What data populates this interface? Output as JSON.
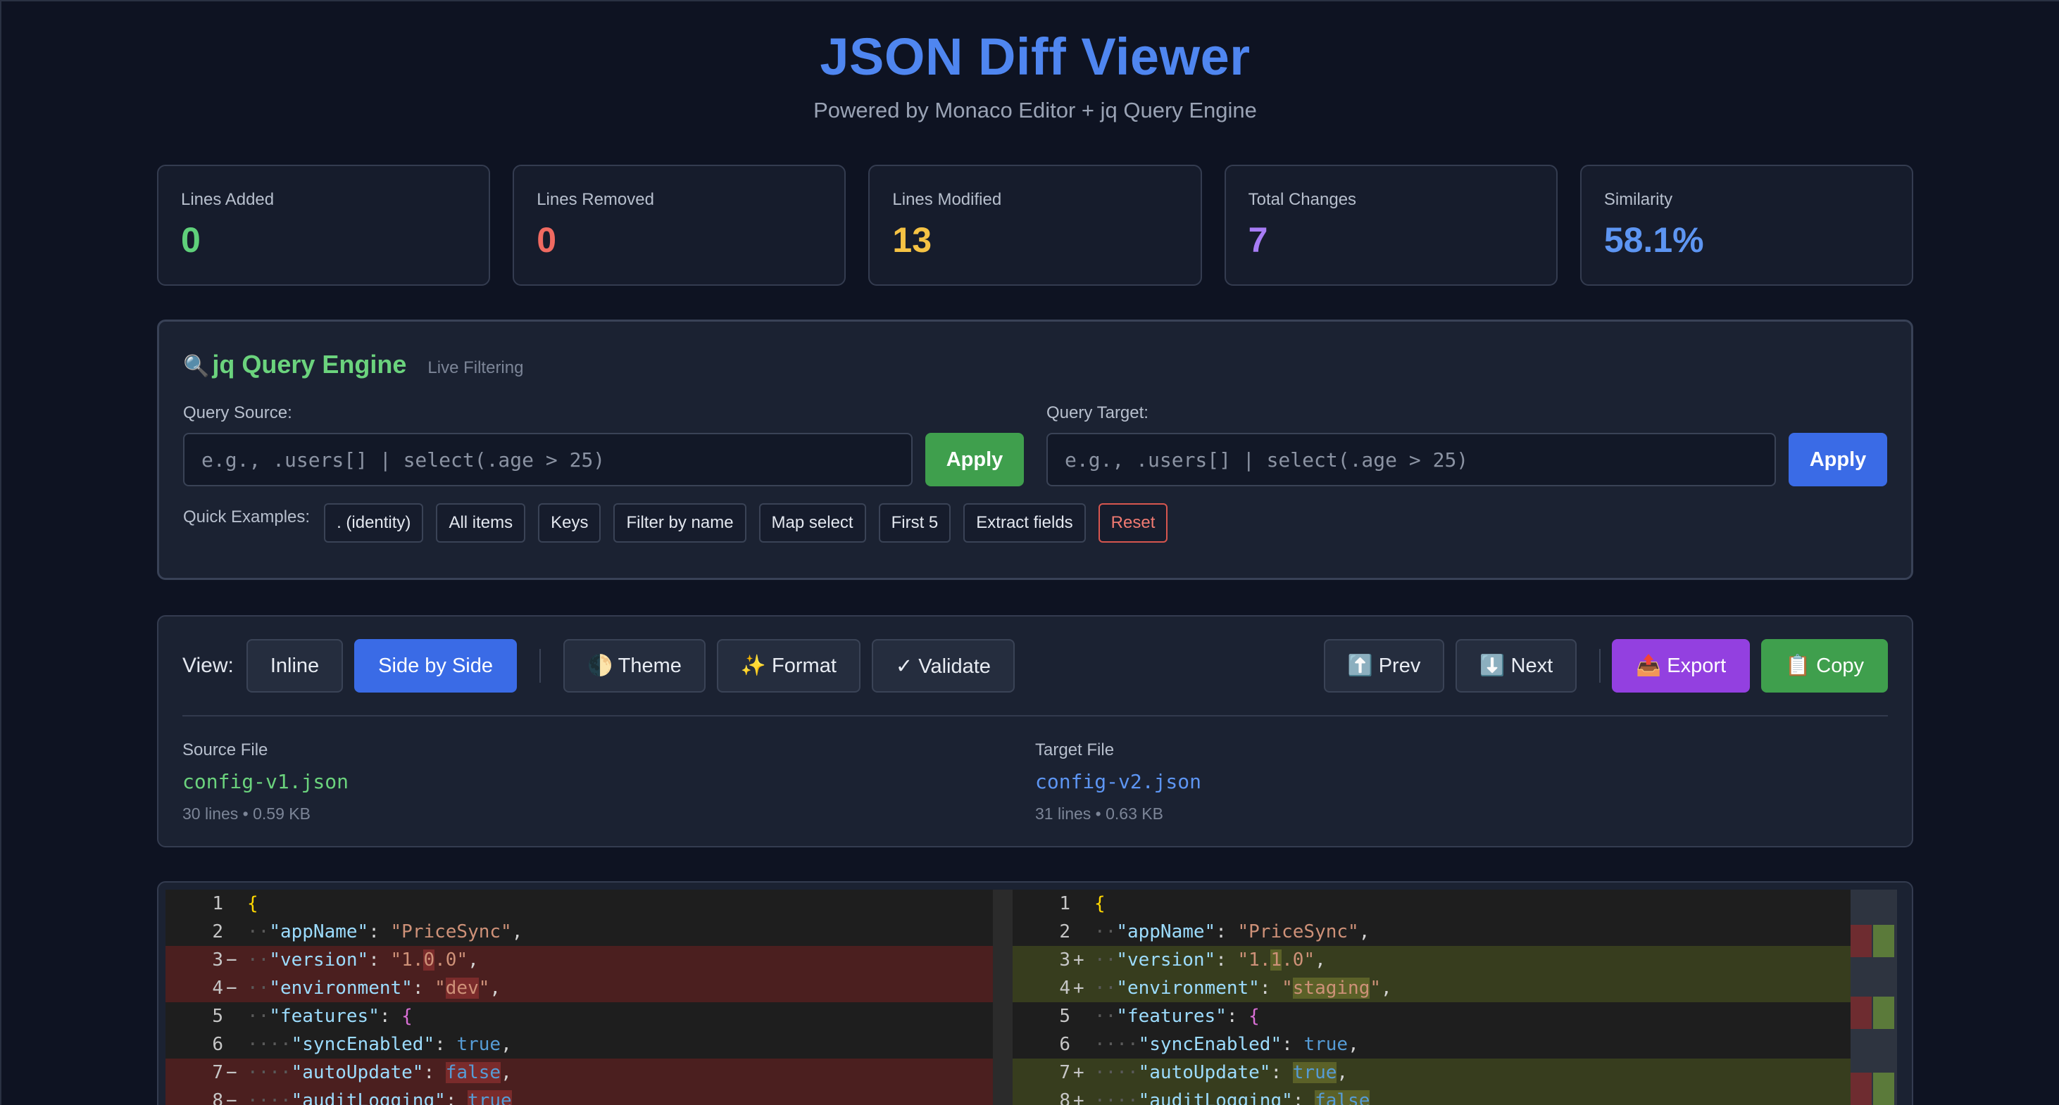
{
  "header": {
    "title": "JSON Diff Viewer",
    "subtitle": "Powered by Monaco Editor + jq Query Engine"
  },
  "stats": [
    {
      "label": "Lines Added",
      "value": "0",
      "color": "#5fd07a"
    },
    {
      "label": "Lines Removed",
      "value": "0",
      "color": "#f06a61"
    },
    {
      "label": "Lines Modified",
      "value": "13",
      "color": "#f5c244"
    },
    {
      "label": "Total Changes",
      "value": "7",
      "color": "#a77cf5"
    },
    {
      "label": "Similarity",
      "value": "58.1%",
      "color": "#5d95f2"
    }
  ],
  "jq": {
    "icon": "🔍",
    "title": "jq Query Engine",
    "badge": "Live Filtering",
    "source_label": "Query Source:",
    "target_label": "Query Target:",
    "placeholder": "e.g., .users[] | select(.age > 25)",
    "source_apply": "Apply",
    "target_apply": "Apply",
    "source_apply_color": "#3f9f4d",
    "target_apply_color": "#3a6be6",
    "examples_label": "Quick Examples:",
    "examples": [
      ". (identity)",
      "All items",
      "Keys",
      "Filter by name",
      "Map select",
      "First 5",
      "Extract fields"
    ],
    "reset": "Reset"
  },
  "toolbar": {
    "view_label": "View:",
    "inline": "Inline",
    "side_by_side": "Side by Side",
    "theme": "🌓 Theme",
    "format": "✨ Format",
    "validate": "✓ Validate",
    "prev": "⬆️ Prev",
    "next": "⬇️ Next",
    "export": "📤 Export",
    "copy": "📋 Copy"
  },
  "files": {
    "source": {
      "label": "Source File",
      "name": "config-v1.json",
      "meta": "30 lines • 0.59 KB",
      "color": "#6bd37d"
    },
    "target": {
      "label": "Target File",
      "name": "config-v2.json",
      "meta": "31 lines • 0.63 KB",
      "color": "#5d95f2"
    }
  },
  "diff": {
    "left": [
      {
        "n": "1",
        "g": "",
        "type": "",
        "html": "<span class='tok-brace'>{</span>"
      },
      {
        "n": "2",
        "g": "",
        "type": "",
        "html": "<span class='dot'>··</span><span class='tok-key'>\"appName\"</span><span class='tok-p'>: </span><span class='tok-str'>\"PriceSync\"</span><span class='tok-p'>,</span>"
      },
      {
        "n": "3",
        "g": "−",
        "type": "del",
        "html": "<span class='dot'>··</span><span class='tok-key'>\"version\"</span><span class='tok-p'>: </span><span class='tok-str'>\"1.<span class='hl'>0</span>.0\"</span><span class='tok-p'>,</span>"
      },
      {
        "n": "4",
        "g": "−",
        "type": "del",
        "html": "<span class='dot'>··</span><span class='tok-key'>\"environment\"</span><span class='tok-p'>: </span><span class='tok-str'>\"<span class='hl'>dev</span>\"</span><span class='tok-p'>,</span>"
      },
      {
        "n": "5",
        "g": "",
        "type": "",
        "html": "<span class='dot'>··</span><span class='tok-key'>\"features\"</span><span class='tok-p'>: </span><span class='tok-brace2'>{</span>"
      },
      {
        "n": "6",
        "g": "",
        "type": "",
        "html": "<span class='dot'>····</span><span class='tok-key'>\"syncEnabled\"</span><span class='tok-p'>: </span><span class='tok-bool'>true</span><span class='tok-p'>,</span>"
      },
      {
        "n": "7",
        "g": "−",
        "type": "del",
        "html": "<span class='dot'>····</span><span class='tok-key'>\"autoUpdate\"</span><span class='tok-p'>: </span><span class='tok-bool hl'>false</span><span class='tok-p'>,</span>"
      },
      {
        "n": "8",
        "g": "−",
        "type": "del",
        "html": "<span class='dot'>····</span><span class='tok-key'>\"auditLogging\"</span><span class='tok-p'>: </span><span class='tok-bool hl'>true</span>"
      }
    ],
    "right": [
      {
        "n": "1",
        "g": "",
        "type": "",
        "html": "<span class='tok-brace'>{</span>"
      },
      {
        "n": "2",
        "g": "",
        "type": "",
        "html": "<span class='dot'>··</span><span class='tok-key'>\"appName\"</span><span class='tok-p'>: </span><span class='tok-str'>\"PriceSync\"</span><span class='tok-p'>,</span>"
      },
      {
        "n": "3",
        "g": "+",
        "type": "add",
        "html": "<span class='dot'>··</span><span class='tok-key'>\"version\"</span><span class='tok-p'>: </span><span class='tok-str'>\"1.<span class='hl'>1</span>.0\"</span><span class='tok-p'>,</span>"
      },
      {
        "n": "4",
        "g": "+",
        "type": "add",
        "html": "<span class='dot'>··</span><span class='tok-key'>\"environment\"</span><span class='tok-p'>: </span><span class='tok-str'>\"<span class='hl'>staging</span>\"</span><span class='tok-p'>,</span>"
      },
      {
        "n": "5",
        "g": "",
        "type": "",
        "html": "<span class='dot'>··</span><span class='tok-key'>\"features\"</span><span class='tok-p'>: </span><span class='tok-brace2'>{</span>"
      },
      {
        "n": "6",
        "g": "",
        "type": "",
        "html": "<span class='dot'>····</span><span class='tok-key'>\"syncEnabled\"</span><span class='tok-p'>: </span><span class='tok-bool'>true</span><span class='tok-p'>,</span>"
      },
      {
        "n": "7",
        "g": "+",
        "type": "add",
        "html": "<span class='dot'>····</span><span class='tok-key'>\"autoUpdate\"</span><span class='tok-p'>: </span><span class='tok-bool hl'>true</span><span class='tok-p'>,</span>"
      },
      {
        "n": "8",
        "g": "+",
        "type": "add",
        "html": "<span class='dot'>····</span><span class='tok-key'>\"auditLogging\"</span><span class='tok-p'>: </span><span class='tok-bool hl'>false</span>"
      }
    ]
  }
}
